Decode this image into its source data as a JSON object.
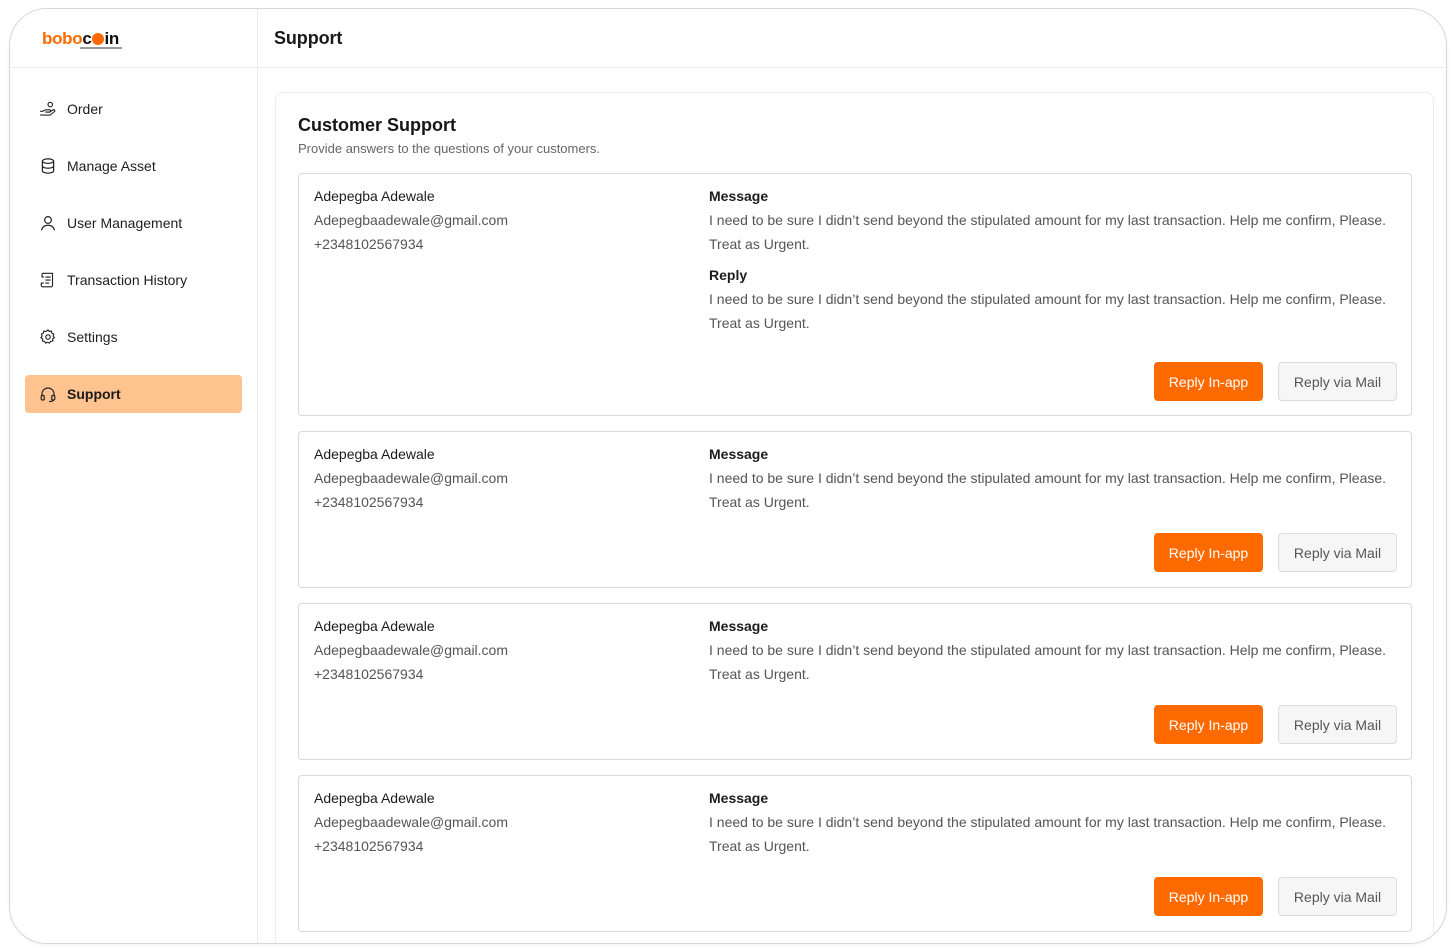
{
  "brand": {
    "logo_part1": "bobo",
    "logo_part2": "c",
    "logo_part3": "in",
    "accent_color": "#ff6a00",
    "active_nav_color": "#ffc38f"
  },
  "sidebar": {
    "items": [
      {
        "label": "Order",
        "icon": "hand-coins-icon"
      },
      {
        "label": "Manage Asset",
        "icon": "database-icon"
      },
      {
        "label": "User Management",
        "icon": "user-icon"
      },
      {
        "label": "Transaction History",
        "icon": "receipt-icon"
      },
      {
        "label": "Settings",
        "icon": "gear-icon"
      },
      {
        "label": "Support",
        "icon": "headset-icon",
        "active": true
      }
    ]
  },
  "header": {
    "title": "Support"
  },
  "main": {
    "title": "Customer Support",
    "subtitle": "Provide answers to the questions of your customers.",
    "tickets": [
      {
        "name": "Adepegba Adewale",
        "email": "Adepegbaadewale@gmail.com",
        "phone": "+2348102567934",
        "message_label": "Message",
        "message": "I need to be sure I didn’t send beyond the stipulated amount for my last transaction.  Help me confirm, Please. Treat as Urgent.",
        "reply_label": "Reply",
        "reply": "I need to be sure I didn’t send beyond the stipulated amount for my last transaction.  Help me confirm, Please. Treat as Urgent.",
        "btn_inapp": "Reply In-app",
        "btn_mail": "Reply via Mail"
      },
      {
        "name": "Adepegba Adewale",
        "email": "Adepegbaadewale@gmail.com",
        "phone": "+2348102567934",
        "message_label": "Message",
        "message": "I need to be sure I didn’t send beyond the stipulated amount for my last transaction.  Help me confirm, Please. Treat as Urgent.",
        "btn_inapp": "Reply In-app",
        "btn_mail": "Reply via Mail"
      },
      {
        "name": "Adepegba Adewale",
        "email": "Adepegbaadewale@gmail.com",
        "phone": "+2348102567934",
        "message_label": "Message",
        "message": "I need to be sure I didn’t send beyond the stipulated amount for my last transaction.  Help me confirm, Please. Treat as Urgent.",
        "btn_inapp": "Reply In-app",
        "btn_mail": "Reply via Mail"
      },
      {
        "name": "Adepegba Adewale",
        "email": "Adepegbaadewale@gmail.com",
        "phone": "+2348102567934",
        "message_label": "Message",
        "message": "I need to be sure I didn’t send beyond the stipulated amount for my last transaction.  Help me confirm, Please. Treat as Urgent.",
        "btn_inapp": "Reply In-app",
        "btn_mail": "Reply via Mail"
      }
    ]
  }
}
